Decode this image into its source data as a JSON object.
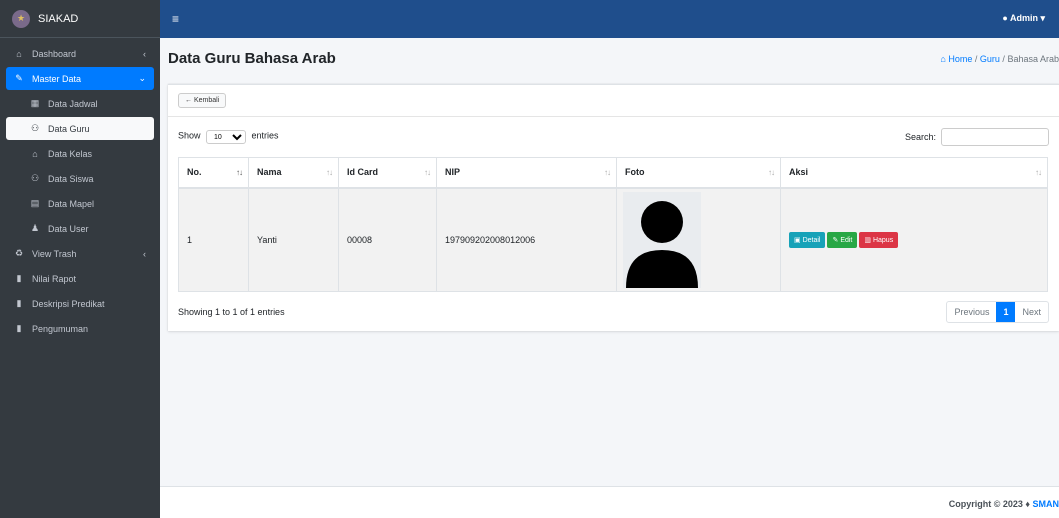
{
  "brand": {
    "name": "SIAKAD"
  },
  "sidebar": {
    "items": [
      {
        "label": "Dashboard",
        "icon": "home-icon"
      },
      {
        "label": "Master Data",
        "icon": "edit-icon"
      },
      {
        "label": "Data Jadwal",
        "icon": "calendar-icon"
      },
      {
        "label": "Data Guru",
        "icon": "users-icon"
      },
      {
        "label": "Data Kelas",
        "icon": "home-icon"
      },
      {
        "label": "Data Siswa",
        "icon": "users-icon"
      },
      {
        "label": "Data Mapel",
        "icon": "book-icon"
      },
      {
        "label": "Data User",
        "icon": "user-plus-icon"
      },
      {
        "label": "View Trash",
        "icon": "recycle-icon"
      },
      {
        "label": "Nilai Rapot",
        "icon": "file-icon"
      },
      {
        "label": "Deskripsi Predikat",
        "icon": "file-icon"
      },
      {
        "label": "Pengumuman",
        "icon": "clipboard-icon"
      }
    ]
  },
  "topbar": {
    "user": "Admin"
  },
  "page": {
    "title": "Data Guru Bahasa Arab"
  },
  "breadcrumb": {
    "home": "Home",
    "sep": "/",
    "guru": "Guru",
    "current": "Bahasa Arab"
  },
  "card": {
    "back_label": "Kembali"
  },
  "table_controls": {
    "show": "Show",
    "length_value": "10",
    "entries": "entries",
    "search_label": "Search:",
    "search_value": ""
  },
  "table": {
    "headers": [
      "No.",
      "Nama",
      "Id Card",
      "NIP",
      "Foto",
      "Aksi"
    ],
    "rows": [
      {
        "no": "1",
        "nama": "Yanti",
        "id_card": "00008",
        "nip": "197909202008012006",
        "foto": "user-silhouette"
      }
    ]
  },
  "actions": {
    "detail": "Detail",
    "edit": "Edit",
    "hapus": "Hapus"
  },
  "pagination": {
    "info": "Showing 1 to 1 of 1 entries",
    "previous": "Previous",
    "current": "1",
    "next": "Next"
  },
  "footer": {
    "copyright": "Copyright © 2023 ♦",
    "accent": "SMAN"
  },
  "colors": {
    "sidebar": "#343a40",
    "topbar": "#1f4e8c",
    "primary": "#007bff",
    "info": "#17a2b8",
    "success": "#28a745",
    "danger": "#dc3545"
  }
}
